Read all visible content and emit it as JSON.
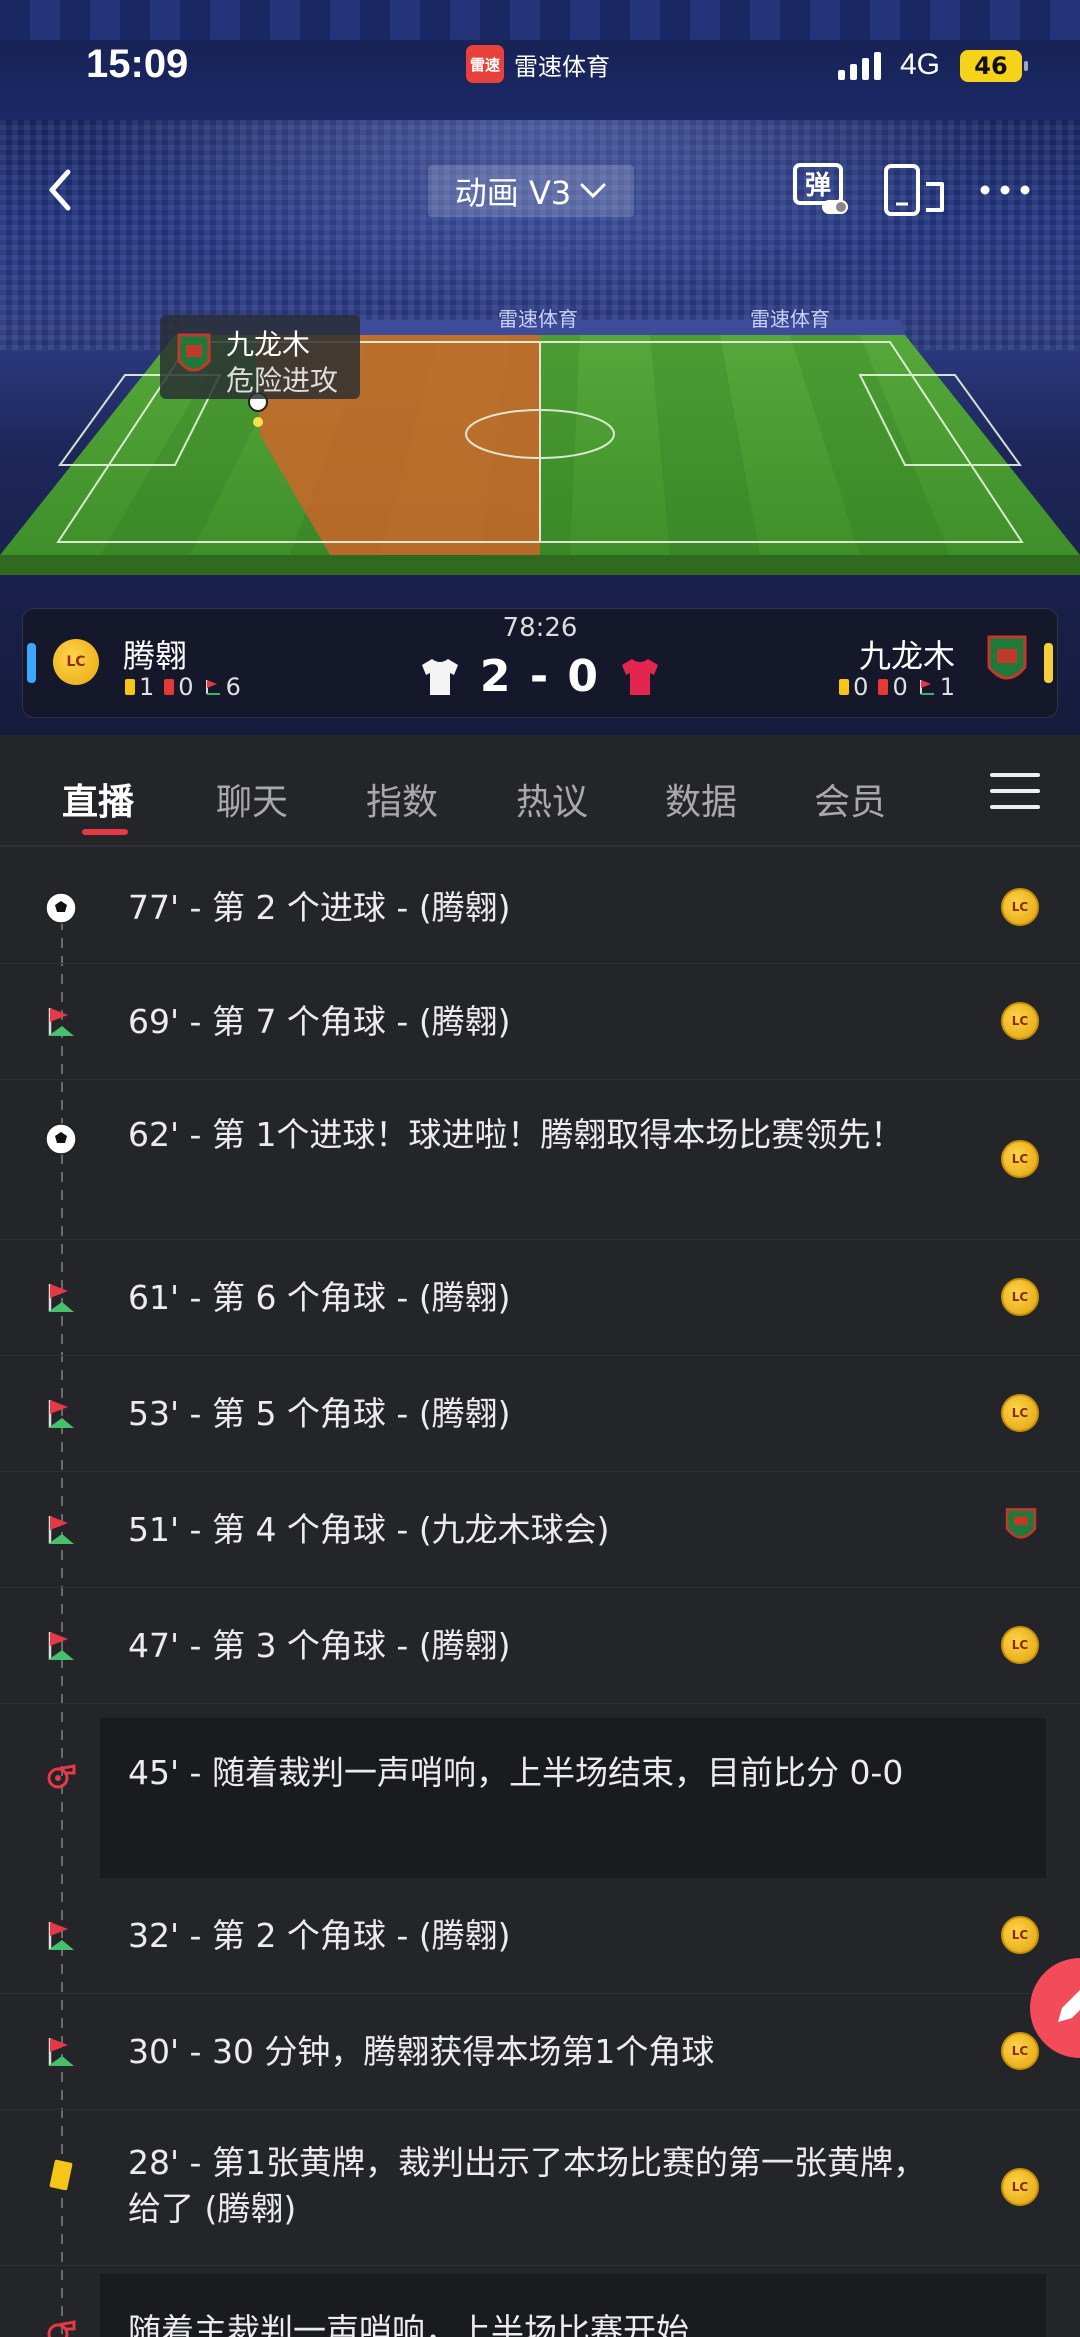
{
  "status_bar": {
    "time": "15:09",
    "app_logo_text": "雷速",
    "app_name": "雷速体育",
    "network": "4G",
    "battery": "46"
  },
  "nav": {
    "animation_mode": "动画 V3",
    "danmu_label": "弹"
  },
  "pitch": {
    "tooltip_team": "九龙木",
    "tooltip_event": "危险进攻",
    "watermark": "雷速体育"
  },
  "match": {
    "minute": "78:26",
    "score": "2 - 0",
    "home": {
      "name": "腾翱",
      "badge_text": "LC",
      "yellow": "1",
      "red": "0",
      "corners": "6",
      "color": "#3aa8ff"
    },
    "away": {
      "name": "九龙木",
      "yellow": "0",
      "red": "0",
      "corners": "1",
      "color": "#f7cf3d"
    }
  },
  "tabs": [
    {
      "label": "直播",
      "active": true
    },
    {
      "label": "聊天"
    },
    {
      "label": "指数"
    },
    {
      "label": "热议"
    },
    {
      "label": "数据"
    },
    {
      "label": "会员"
    }
  ],
  "events": [
    {
      "icon": "soccer-ball-icon",
      "text": "77' - 第 2 个进球 - (腾翱)",
      "team": "home"
    },
    {
      "icon": "corner-flag-icon",
      "text": "69' - 第 7 个角球 - (腾翱)",
      "team": "home"
    },
    {
      "icon": "soccer-ball-icon",
      "text": "62' - 第 1个进球！球进啦！腾翱取得本场比赛领先！",
      "team": "home"
    },
    {
      "icon": "corner-flag-icon",
      "text": "61' - 第 6 个角球 - (腾翱)",
      "team": "home"
    },
    {
      "icon": "corner-flag-icon",
      "text": "53' - 第 5 个角球 - (腾翱)",
      "team": "home"
    },
    {
      "icon": "corner-flag-icon",
      "text": "51' - 第 4 个角球 - (九龙木球会)",
      "team": "away"
    },
    {
      "icon": "corner-flag-icon",
      "text": "47' - 第 3 个角球 - (腾翱)",
      "team": "home"
    },
    {
      "icon": "whistle-icon",
      "text": "45' - 随着裁判一声哨响，上半场结束，目前比分 0-0",
      "team": "none"
    },
    {
      "icon": "corner-flag-icon",
      "text": "32' - 第 2 个角球 - (腾翱)",
      "team": "home"
    },
    {
      "icon": "corner-flag-icon",
      "text": "30' - 30 分钟，腾翱获得本场第1个角球",
      "team": "home"
    },
    {
      "icon": "yellow-card-icon",
      "text": "28' - 第1张黄牌，裁判出示了本场比赛的第一张黄牌，给了 (腾翱)",
      "team": "home"
    },
    {
      "icon": "whistle-icon",
      "text": "随着主裁判一声哨响，上半场比赛开始",
      "team": "none"
    }
  ]
}
